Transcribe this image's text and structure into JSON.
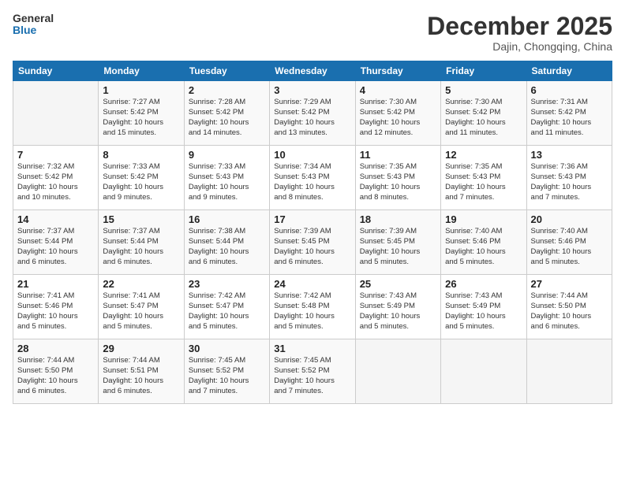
{
  "header": {
    "logo_general": "General",
    "logo_blue": "Blue",
    "month_title": "December 2025",
    "subtitle": "Dajin, Chongqing, China"
  },
  "days_of_week": [
    "Sunday",
    "Monday",
    "Tuesday",
    "Wednesday",
    "Thursday",
    "Friday",
    "Saturday"
  ],
  "weeks": [
    [
      {
        "day": "",
        "info": ""
      },
      {
        "day": "1",
        "info": "Sunrise: 7:27 AM\nSunset: 5:42 PM\nDaylight: 10 hours\nand 15 minutes."
      },
      {
        "day": "2",
        "info": "Sunrise: 7:28 AM\nSunset: 5:42 PM\nDaylight: 10 hours\nand 14 minutes."
      },
      {
        "day": "3",
        "info": "Sunrise: 7:29 AM\nSunset: 5:42 PM\nDaylight: 10 hours\nand 13 minutes."
      },
      {
        "day": "4",
        "info": "Sunrise: 7:30 AM\nSunset: 5:42 PM\nDaylight: 10 hours\nand 12 minutes."
      },
      {
        "day": "5",
        "info": "Sunrise: 7:30 AM\nSunset: 5:42 PM\nDaylight: 10 hours\nand 11 minutes."
      },
      {
        "day": "6",
        "info": "Sunrise: 7:31 AM\nSunset: 5:42 PM\nDaylight: 10 hours\nand 11 minutes."
      }
    ],
    [
      {
        "day": "7",
        "info": "Sunrise: 7:32 AM\nSunset: 5:42 PM\nDaylight: 10 hours\nand 10 minutes."
      },
      {
        "day": "8",
        "info": "Sunrise: 7:33 AM\nSunset: 5:42 PM\nDaylight: 10 hours\nand 9 minutes."
      },
      {
        "day": "9",
        "info": "Sunrise: 7:33 AM\nSunset: 5:43 PM\nDaylight: 10 hours\nand 9 minutes."
      },
      {
        "day": "10",
        "info": "Sunrise: 7:34 AM\nSunset: 5:43 PM\nDaylight: 10 hours\nand 8 minutes."
      },
      {
        "day": "11",
        "info": "Sunrise: 7:35 AM\nSunset: 5:43 PM\nDaylight: 10 hours\nand 8 minutes."
      },
      {
        "day": "12",
        "info": "Sunrise: 7:35 AM\nSunset: 5:43 PM\nDaylight: 10 hours\nand 7 minutes."
      },
      {
        "day": "13",
        "info": "Sunrise: 7:36 AM\nSunset: 5:43 PM\nDaylight: 10 hours\nand 7 minutes."
      }
    ],
    [
      {
        "day": "14",
        "info": "Sunrise: 7:37 AM\nSunset: 5:44 PM\nDaylight: 10 hours\nand 6 minutes."
      },
      {
        "day": "15",
        "info": "Sunrise: 7:37 AM\nSunset: 5:44 PM\nDaylight: 10 hours\nand 6 minutes."
      },
      {
        "day": "16",
        "info": "Sunrise: 7:38 AM\nSunset: 5:44 PM\nDaylight: 10 hours\nand 6 minutes."
      },
      {
        "day": "17",
        "info": "Sunrise: 7:39 AM\nSunset: 5:45 PM\nDaylight: 10 hours\nand 6 minutes."
      },
      {
        "day": "18",
        "info": "Sunrise: 7:39 AM\nSunset: 5:45 PM\nDaylight: 10 hours\nand 5 minutes."
      },
      {
        "day": "19",
        "info": "Sunrise: 7:40 AM\nSunset: 5:46 PM\nDaylight: 10 hours\nand 5 minutes."
      },
      {
        "day": "20",
        "info": "Sunrise: 7:40 AM\nSunset: 5:46 PM\nDaylight: 10 hours\nand 5 minutes."
      }
    ],
    [
      {
        "day": "21",
        "info": "Sunrise: 7:41 AM\nSunset: 5:46 PM\nDaylight: 10 hours\nand 5 minutes."
      },
      {
        "day": "22",
        "info": "Sunrise: 7:41 AM\nSunset: 5:47 PM\nDaylight: 10 hours\nand 5 minutes."
      },
      {
        "day": "23",
        "info": "Sunrise: 7:42 AM\nSunset: 5:47 PM\nDaylight: 10 hours\nand 5 minutes."
      },
      {
        "day": "24",
        "info": "Sunrise: 7:42 AM\nSunset: 5:48 PM\nDaylight: 10 hours\nand 5 minutes."
      },
      {
        "day": "25",
        "info": "Sunrise: 7:43 AM\nSunset: 5:49 PM\nDaylight: 10 hours\nand 5 minutes."
      },
      {
        "day": "26",
        "info": "Sunrise: 7:43 AM\nSunset: 5:49 PM\nDaylight: 10 hours\nand 5 minutes."
      },
      {
        "day": "27",
        "info": "Sunrise: 7:44 AM\nSunset: 5:50 PM\nDaylight: 10 hours\nand 6 minutes."
      }
    ],
    [
      {
        "day": "28",
        "info": "Sunrise: 7:44 AM\nSunset: 5:50 PM\nDaylight: 10 hours\nand 6 minutes."
      },
      {
        "day": "29",
        "info": "Sunrise: 7:44 AM\nSunset: 5:51 PM\nDaylight: 10 hours\nand 6 minutes."
      },
      {
        "day": "30",
        "info": "Sunrise: 7:45 AM\nSunset: 5:52 PM\nDaylight: 10 hours\nand 7 minutes."
      },
      {
        "day": "31",
        "info": "Sunrise: 7:45 AM\nSunset: 5:52 PM\nDaylight: 10 hours\nand 7 minutes."
      },
      {
        "day": "",
        "info": ""
      },
      {
        "day": "",
        "info": ""
      },
      {
        "day": "",
        "info": ""
      }
    ]
  ]
}
